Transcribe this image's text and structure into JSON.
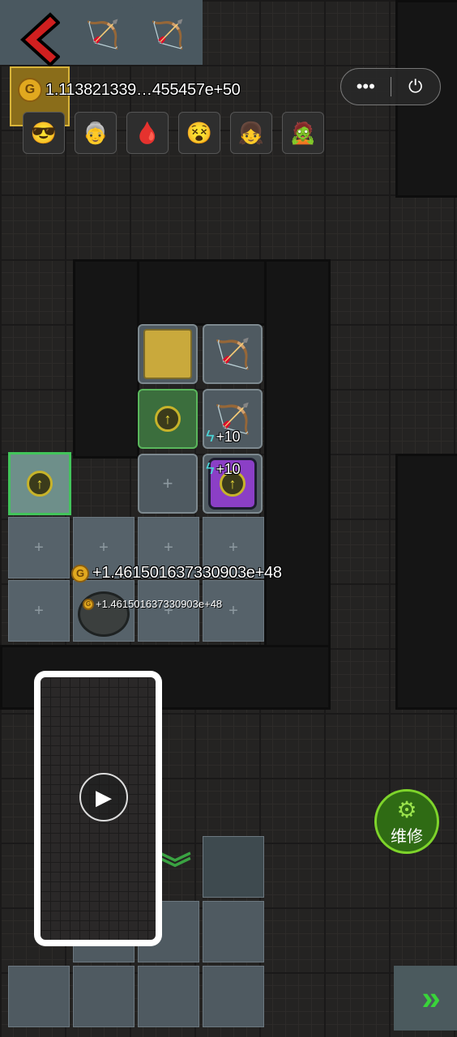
{
  "hud": {
    "coin_glyph": "G",
    "gold_amount": "1.113821339…455457e+50",
    "menu_dots": "•••",
    "power_icon_glyph": "⏻"
  },
  "party": [
    {
      "name": "avatar-1",
      "glyph": "😎"
    },
    {
      "name": "avatar-2",
      "glyph": "👵"
    },
    {
      "name": "avatar-3",
      "glyph": "🩸"
    },
    {
      "name": "avatar-4",
      "glyph": "😵"
    },
    {
      "name": "avatar-5",
      "glyph": "👧"
    },
    {
      "name": "avatar-6",
      "glyph": "🧟"
    }
  ],
  "board": {
    "empty_slot_glyph": "+",
    "upgrade_glyph": "↑",
    "bonus_a": "+10",
    "bonus_b": "+10",
    "income_large": "+1.461501637330903e+48",
    "income_small": "+1.461501637330903e+48"
  },
  "repair_button": {
    "label": "维修",
    "icon": "wrench-gear-icon"
  },
  "video_overlay": {
    "play_glyph": "▶"
  },
  "next_button": {
    "glyph": "»"
  },
  "colors": {
    "accent_green": "#7ed42b",
    "gold": "#e1a81f",
    "back_red": "#d01f1f"
  }
}
